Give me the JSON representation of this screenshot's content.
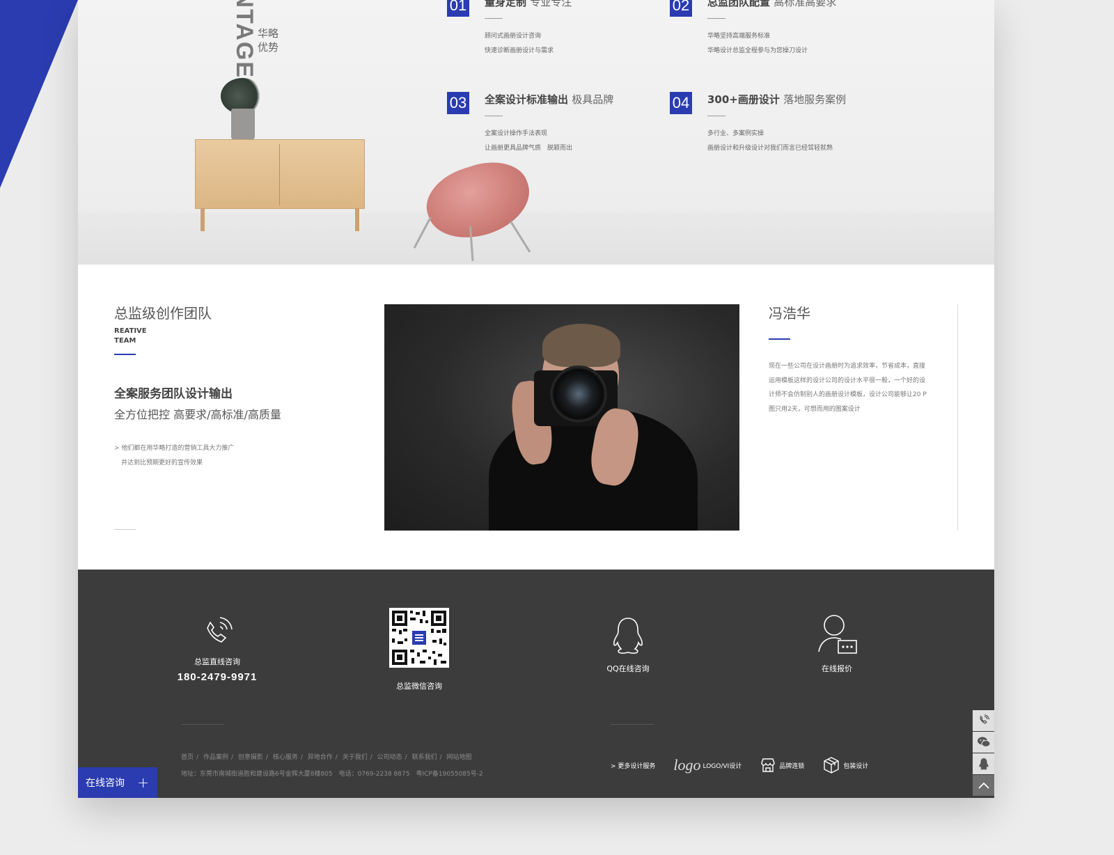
{
  "hero": {
    "vertical_en": "ANTAGE.",
    "vertical_cn": "华略优势",
    "advantages": [
      {
        "num": "01",
        "title_bold": "量身定制",
        "title_light": "专业专注",
        "line1": "顾问式画册设计咨询",
        "line2": "快速诊断画册设计与需求"
      },
      {
        "num": "02",
        "title_bold": "总监团队配置",
        "title_light": "高标准高要求",
        "line1": "华略坚持高端服务标准",
        "line2": "华略设计总监全程参与为您操刀设计"
      },
      {
        "num": "03",
        "title_bold": "全案设计标准输出",
        "title_light": "极具品牌",
        "line1": "全案设计操作手法表现",
        "line2": "让画册更具品牌气质　脱颖而出"
      },
      {
        "num": "04",
        "title_bold": "300+画册设计",
        "title_light": "落地服务案例",
        "line1": "多行业、多案例实操",
        "line2": "画册设计和升级设计对我们而言已经驾轻就熟"
      }
    ]
  },
  "team": {
    "title": "总监级创作团队",
    "en_line1": "REATIVE",
    "en_line2": "TEAM",
    "headline": "全案服务团队设计输出",
    "subline": "全方位把控 高要求/高标准/高质量",
    "note1": "> 他们都在用华略打造的营销工具大力推广",
    "note2": "并达到比预期更好的宣传效果"
  },
  "person": {
    "name": "冯浩华",
    "description": "现在一些公司在设计画册时为追求效率，节省成本，直接运用模板这样的设计公司的设计水平很一般，一个好的设计师不会仿制别人的画册设计模板，设计公司能够让20 P图只用2天，可想而用的图案设计"
  },
  "footer": {
    "phone_label": "总监直线咨询",
    "phone_number": "180-2479-9971",
    "wechat_label": "总监微信咨询",
    "qq_label": "QQ在线咨询",
    "quote_label": "在线报价",
    "nav": [
      "首页",
      "作品案例",
      "创意摄影",
      "核心服务",
      "异地合作",
      "关于我们",
      "公司动态",
      "联系我们",
      "网站地图"
    ],
    "address": "地址：东莞市南城街道胜和建设路6号金辉大厦8楼805　电话：0769-2238  8875　粤ICP备19055085号-2",
    "services_more": "> 更多设计服务",
    "services": [
      {
        "label": "LOGO/VI设计",
        "icon": "logo-icon"
      },
      {
        "label": "品牌连锁",
        "icon": "store-icon"
      },
      {
        "label": "包装设计",
        "icon": "package-icon"
      }
    ],
    "logo_word": "logo"
  },
  "consult": {
    "label": "在线咨询",
    "plus": "+"
  },
  "colors": {
    "accent": "#2a3cb0",
    "footer_bg": "#3c3c3c"
  }
}
